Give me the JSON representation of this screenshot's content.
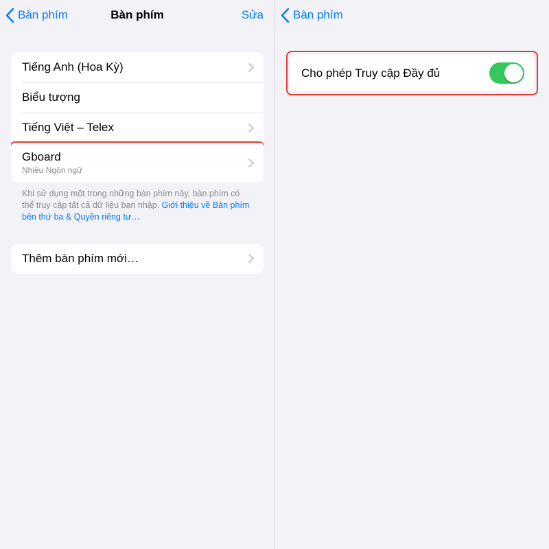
{
  "left": {
    "nav": {
      "back": "Bàn phím",
      "title": "Bàn phím",
      "edit": "Sửa"
    },
    "keyboards": [
      {
        "label": "Tiếng Anh (Hoa Kỳ)",
        "sub": ""
      },
      {
        "label": "Biểu tượng",
        "sub": ""
      },
      {
        "label": "Tiếng Việt – Telex",
        "sub": ""
      },
      {
        "label": "Gboard",
        "sub": "Nhiều Ngôn ngữ"
      }
    ],
    "footer": {
      "text": "Khi sử dụng một trong những bàn phím này, bàn phím có thể truy cập tất cả dữ liệu bạn nhập. ",
      "link": "Giới thiệu về Bàn phím bên thứ ba & Quyền riêng tư…"
    },
    "add": "Thêm bàn phím mới…"
  },
  "right": {
    "nav": {
      "back": "Bàn phím"
    },
    "fullAccess": "Cho phép Truy cập Đầy đủ"
  }
}
